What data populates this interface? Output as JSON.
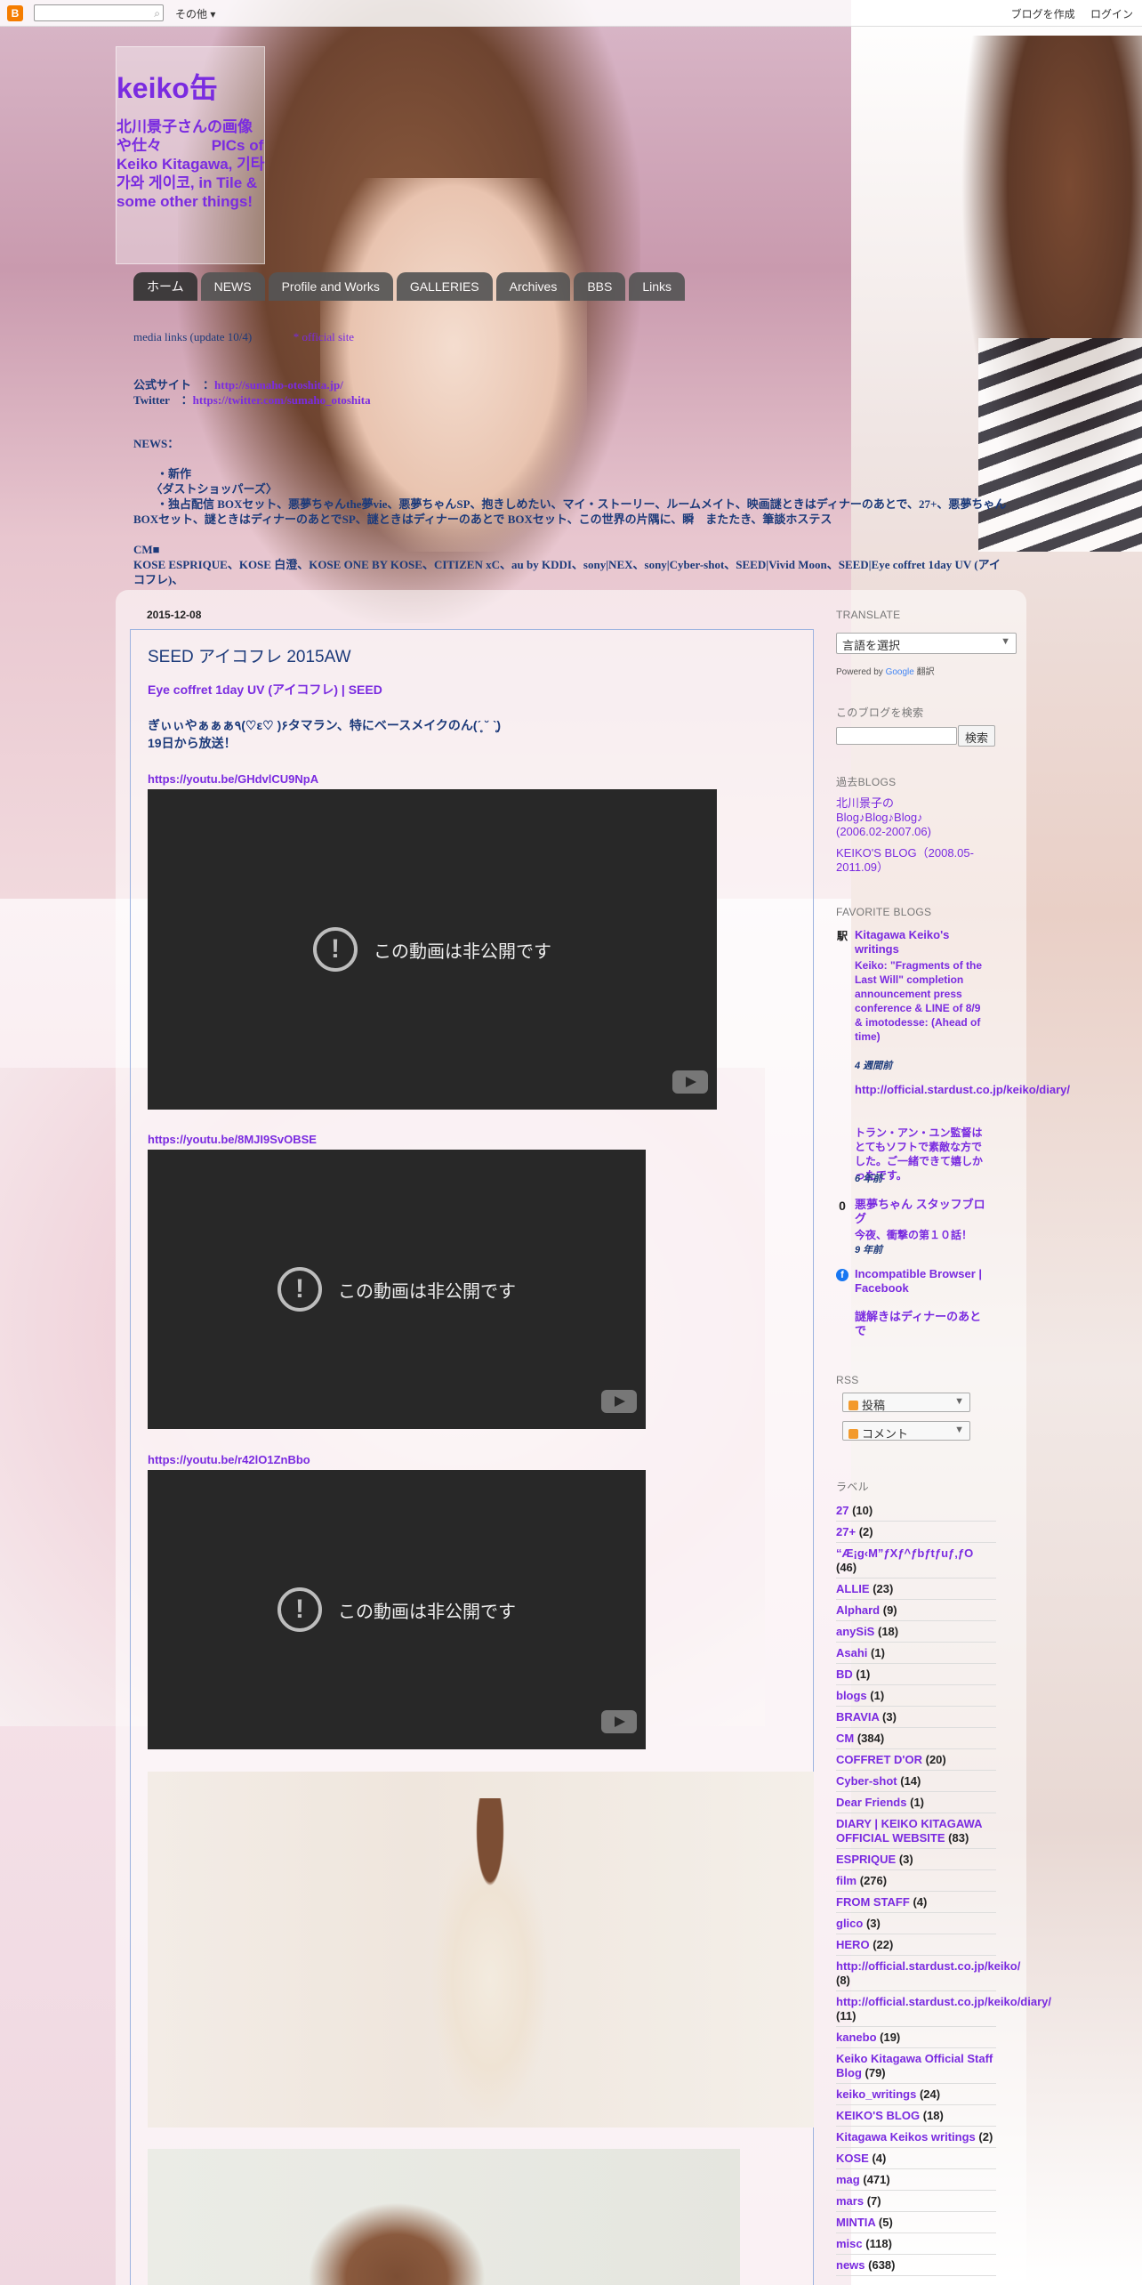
{
  "navbar": {
    "logo": "B",
    "more_label": "その他",
    "create_blog": "ブログを作成",
    "login": "ログイン"
  },
  "header": {
    "title": "keiko缶",
    "description": "北川景子さんの画像や仕々　　　 PICs of Keiko Kitagawa, 기타가와 게이코, in Tile & some other things!"
  },
  "tabs": [
    "ホーム",
    "NEWS",
    "Profile and Works",
    "GALLERIES",
    "Archives",
    "BBS",
    "Links"
  ],
  "crosscol": {
    "line1_left": "media links (update 10/4)",
    "line1_right": "* official site",
    "line2_prefix": "公式サイト　：",
    "line2_link": "http://sumaho-otoshita.jp/",
    "line3_prefix": "Twitter　：",
    "line3_link": "https://twitter.com/sumaho_otoshita",
    "line4": "NEWS：",
    "line5": "　　・新作",
    "line6": "　　〈ダストショッパーズ〉",
    "line7": "　　・独占配信 BOXセット、悪夢ちゃんthe夢vie、悪夢ちゃんSP、抱きしめたい、マイ・ストーリー、ルームメイト、映画謎ときはディナーのあとで、27+、悪夢ちゃん BOXセット、謎ときはディナーのあとでSP、謎ときはディナーのあとで BOXセット、この世界の片隅に、瞬　またたき、筆談ホステス",
    "line8": "CM■",
    "line9": "KOSE ESPRIQUE、KOSE 白澄、KOSE ONE BY KOSE、CITIZEN xC、au by KDDI、sony|NEX、sony|Cyber-shot、SEED|Vivid Moon、SEED|Eye coffret 1day UV (アイコフレ)、"
  },
  "post": {
    "date": "2015-12-08",
    "title": "SEED アイコフレ 2015AW",
    "link1": "Eye coffret 1day UV (アイコフレ) | SEED",
    "text1": "ぎぃぃやぁぁぁ٩(♡ε♡ )۶タマラン、特にベースメイクのん(ˊ̥̥̥̥̥ ˘ ˋ̥̥̥̥̥)",
    "text2": "19日から放送！",
    "video_url1": "https://youtu.be/GHdvlCU9NpA",
    "video_url2": "https://youtu.be/8MJI9SvOBSE",
    "video_url3": "https://youtu.be/r42lO1ZnBbo",
    "video_message": "この動画は非公開です"
  },
  "sidebar": {
    "translate_head": "TRANSLATE",
    "translate_select": "言語を選択",
    "powered_by": "Powered by",
    "google": "Google",
    "translate_word": "翻訳",
    "search_head": "このブログを検索",
    "search_button": "検索",
    "past_head": "過去BLOGS",
    "past1": "北川景子の Blog♪Blog♪Blog♪ (2006.02-2007.06)",
    "past2": "KEIKO'S BLOG（2008.05-2011.09）",
    "fav_head": "FAVORITE BLOGS",
    "fav1_title": "Kitagawa Keiko's writings",
    "fav1_post": "Keiko: \"Fragments of the Last Will\" completion announcement press conference & LINE of 8/9 & imotodesse: (Ahead of time)",
    "fav1_time": "4 週間前",
    "fav2_title": "http://official.stardust.co.jp/keiko/diary/",
    "fav2_post": "トラン・アン・ユン監督はとてもソフトで素敵な方でした。ご一緒できて嬉しかったです。",
    "fav2_time": "6 年前",
    "fav3_title": "悪夢ちゃん スタッフブログ",
    "fav3_post": "今夜、衝撃の第１０話！",
    "fav3_time": "9 年前",
    "fav4_title": "Incompatible Browser | Facebook",
    "fav5_title": "謎解きはディナーのあとで",
    "rss_head": "RSS",
    "rss1": "投稿",
    "rss2": "コメント",
    "labels_head": "ラベル",
    "labels": [
      {
        "name": "27",
        "count": "(10)"
      },
      {
        "name": "27+",
        "count": "(2)"
      },
      {
        "name": "“Æ¡g‹M”ƒXƒ^ƒbƒtƒuƒ‚ƒO",
        "count": "(46)"
      },
      {
        "name": "ALLIE",
        "count": "(23)"
      },
      {
        "name": "Alphard",
        "count": "(9)"
      },
      {
        "name": "anySiS",
        "count": "(18)"
      },
      {
        "name": "Asahi",
        "count": "(1)"
      },
      {
        "name": "BD",
        "count": "(1)"
      },
      {
        "name": "blogs",
        "count": "(1)"
      },
      {
        "name": "BRAVIA",
        "count": "(3)"
      },
      {
        "name": "CM",
        "count": "(384)"
      },
      {
        "name": "COFFRET D'OR",
        "count": "(20)"
      },
      {
        "name": "Cyber-shot",
        "count": "(14)"
      },
      {
        "name": "Dear Friends",
        "count": "(1)"
      },
      {
        "name": "DIARY | KEIKO KITAGAWA OFFICIAL WEBSITE",
        "count": "(83)"
      },
      {
        "name": "ESPRIQUE",
        "count": "(3)"
      },
      {
        "name": "film",
        "count": "(276)"
      },
      {
        "name": "FROM STAFF",
        "count": "(4)"
      },
      {
        "name": "glico",
        "count": "(3)"
      },
      {
        "name": "HERO",
        "count": "(22)"
      },
      {
        "name": "http://official.stardust.co.jp/keiko/",
        "count": "(8)"
      },
      {
        "name": "http://official.stardust.co.jp/keiko/diary/",
        "count": "(11)"
      },
      {
        "name": "kanebo",
        "count": "(19)"
      },
      {
        "name": "Keiko Kitagawa Official Staff Blog",
        "count": "(79)"
      },
      {
        "name": "keiko_writings",
        "count": "(24)"
      },
      {
        "name": "KEIKO'S BLOG",
        "count": "(18)"
      },
      {
        "name": "Kitagawa Keikos writings",
        "count": "(2)"
      },
      {
        "name": "KOSE",
        "count": "(4)"
      },
      {
        "name": "mag",
        "count": "(471)"
      },
      {
        "name": "mars",
        "count": "(7)"
      },
      {
        "name": "MINTIA",
        "count": "(5)"
      },
      {
        "name": "misc",
        "count": "(118)"
      },
      {
        "name": "news",
        "count": "(638)"
      }
    ]
  }
}
